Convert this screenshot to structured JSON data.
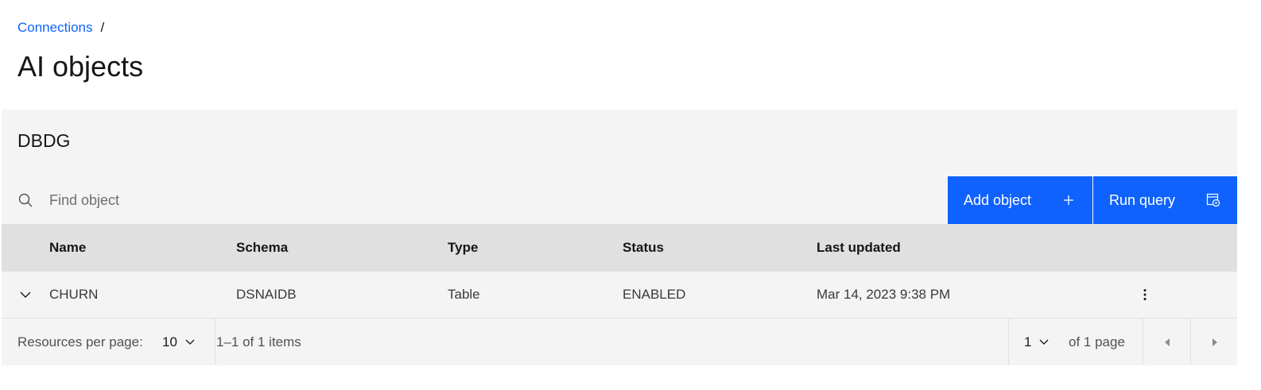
{
  "breadcrumb": {
    "link": "Connections",
    "separator": "/"
  },
  "page": {
    "title": "AI objects"
  },
  "panel": {
    "title": "DBDG"
  },
  "search": {
    "placeholder": "Find object",
    "value": ""
  },
  "toolbar": {
    "add_label": "Add object",
    "run_label": "Run query"
  },
  "table": {
    "headers": [
      "Name",
      "Schema",
      "Type",
      "Status",
      "Last updated"
    ],
    "rows": [
      {
        "name": "CHURN",
        "schema": "DSNAIDB",
        "type": "Table",
        "status": "ENABLED",
        "last_updated": "Mar 14, 2023 9:38 PM"
      }
    ]
  },
  "pagination": {
    "per_page_label": "Resources per page:",
    "per_page_value": "10",
    "range_text": "1–1 of 1 items",
    "page_value": "1",
    "page_total_text": "of 1 page"
  },
  "colors": {
    "primary": "#0f62fe",
    "panel_bg": "#f4f4f4",
    "header_bg": "#e0e0e0"
  },
  "icons": [
    "search-icon",
    "plus-icon",
    "run-query-icon",
    "chevron-down-icon",
    "overflow-menu-icon",
    "caret-left-icon",
    "caret-right-icon"
  ]
}
